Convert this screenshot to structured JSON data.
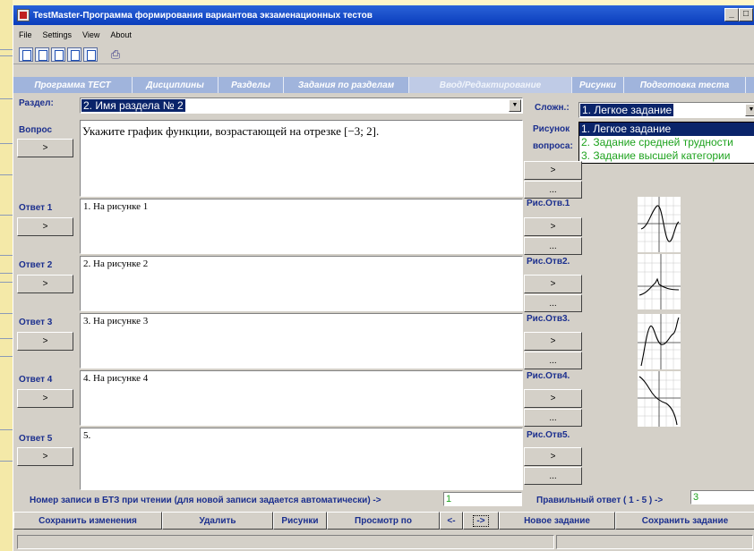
{
  "window": {
    "title": "TestMaster-Программа формирования вариантова экзаменационных тестов",
    "minimize": "_",
    "maximize": "□"
  },
  "menu": [
    "File",
    "Settings",
    "View",
    "About"
  ],
  "tabs": [
    "Программа ТЕСТ",
    "Дисциплины",
    "Разделы",
    "Задания по разделам",
    "Ввод/Редактирование",
    "Рисунки",
    "Подготовка теста"
  ],
  "section": {
    "label": "Раздел:",
    "value": "2. Имя раздела № 2"
  },
  "difficulty": {
    "label": "Сложн.:",
    "value": "1. Легкое задание",
    "options": [
      "1. Легкое задание",
      "2. Задание средней трудности",
      "3. Задание высшей категории"
    ]
  },
  "question": {
    "label": "Вопрос",
    "button": ">",
    "text": "Укажите график функции, возрастающей на отрезке [−3; 2].",
    "picture_label_1": "Рисунок",
    "picture_label_2": "вопроса:",
    "pic_button": ">",
    "pic_more": "..."
  },
  "answers": [
    {
      "label": "Ответ 1",
      "button": ">",
      "text": "1. На рисунке 1",
      "pic_label": "Рис.Отв.1",
      "pic_button": ">",
      "pic_more": "..."
    },
    {
      "label": "Ответ 2",
      "button": ">",
      "text": "2.  На рисунке 2",
      "pic_label": "Рис.Отв2.",
      "pic_button": ">",
      "pic_more": "..."
    },
    {
      "label": "Ответ 3",
      "button": ">",
      "text": "3.  На рисунке 3",
      "pic_label": "Рис.Отв3.",
      "pic_button": ">",
      "pic_more": "..."
    },
    {
      "label": "Ответ 4",
      "button": ">",
      "text": "4.  На рисунке 4",
      "pic_label": "Рис.Отв4.",
      "pic_button": ">",
      "pic_more": "..."
    },
    {
      "label": "Ответ 5",
      "button": ">",
      "text": "5.",
      "pic_label": "Рис.Отв5.",
      "pic_button": ">",
      "pic_more": "..."
    }
  ],
  "record": {
    "label": "Номер записи в БТЗ при чтении (для новой записи задается автоматически) ->",
    "value": "1"
  },
  "correct": {
    "label": "Правильный ответ ( 1 - 5 ) ->",
    "value": "3"
  },
  "bottom_buttons": {
    "save_changes": "Сохранить изменения",
    "delete": "Удалить",
    "pictures": "Рисунки",
    "view": "Просмотр по",
    "prev": "<-",
    "next": "->",
    "new_task": "Новое задание",
    "save_task": "Сохранить задание"
  },
  "colors": {
    "label_blue": "#1b2f8e",
    "select_navy": "#0a246a",
    "value_green": "#1fa31f",
    "tab_blue": "#a0b4dc"
  }
}
